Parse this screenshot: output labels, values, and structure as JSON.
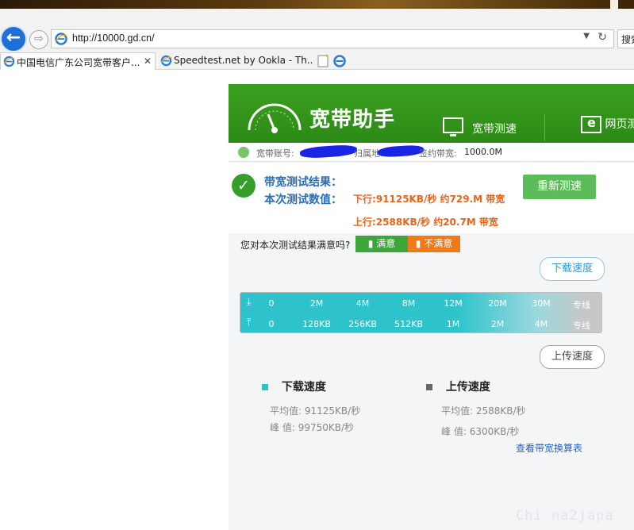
{
  "browser": {
    "url": "http://10000.gd.cn/",
    "search_label": "搜索",
    "tabs": [
      {
        "label": "中国电信广东公司宽带客户..."
      },
      {
        "label": "Speedtest.net by Ookla - Th..."
      }
    ]
  },
  "app": {
    "title": "宽带助手",
    "nav": {
      "speedtest": "宽带测速",
      "webpage": "网页测"
    },
    "account": {
      "account_label": "宽带账号:",
      "location_label": "归属地:",
      "plan_label": "签约带宽:",
      "plan_value": "1000.0M"
    },
    "result": {
      "heading": "带宽测试结果：",
      "values_label": "本次测试数值：",
      "download": "下行:91125KB/秒 约729.M 带宽",
      "upload": "上行:2588KB/秒 约20.7M 带宽",
      "retest_button": "重新测速"
    },
    "satisfaction": {
      "question": "您对本次测试结果满意吗?",
      "yes": "满意",
      "no": "不满意"
    },
    "gauge": {
      "download_bubble": "下载速度",
      "upload_bubble": "上传速度",
      "download_ticks": [
        "0",
        "2M",
        "4M",
        "8M",
        "12M",
        "20M",
        "30M",
        "专线"
      ],
      "upload_ticks": [
        "0",
        "128KB",
        "256KB",
        "512KB",
        "1M",
        "2M",
        "4M",
        "专线"
      ]
    },
    "stats": {
      "download": {
        "title": "下载速度",
        "avg_label": "平均值:",
        "avg": "91125KB/秒",
        "peak_label": "峰 值:",
        "peak": "99750KB/秒",
        "color": "#2ec3cc"
      },
      "upload": {
        "title": "上传速度",
        "avg_label": "平均值:",
        "avg": "2588KB/秒",
        "peak_label": "峰 值:",
        "peak": "6300KB/秒",
        "color": "#666666"
      },
      "calc_link": "查看带宽换算表"
    }
  },
  "watermark": "Chi na2japa"
}
